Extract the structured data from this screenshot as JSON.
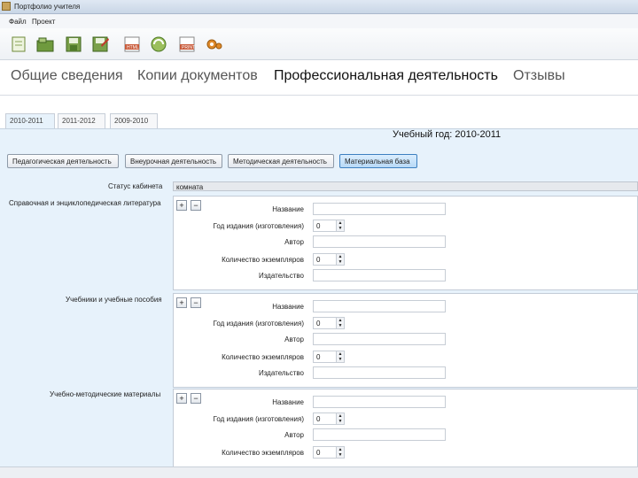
{
  "window": {
    "title": "Портфолио учителя"
  },
  "menu": {
    "items": [
      "Файл",
      "Проект"
    ]
  },
  "toolbar": {
    "icons": [
      "new-document-icon",
      "open-folder-icon",
      "save-icon",
      "save-as-icon",
      "export-html-icon",
      "refresh-icon",
      "print-icon",
      "settings-gear-icon"
    ]
  },
  "nav": {
    "tabs": [
      {
        "label": "Общие сведения",
        "active": false
      },
      {
        "label": "Копии документов",
        "active": false
      },
      {
        "label": "Профессиональная деятельность",
        "active": true
      },
      {
        "label": "Отзывы",
        "active": false
      }
    ]
  },
  "year_tabs": [
    {
      "label": "2010-2011",
      "active": true
    },
    {
      "label": "2011-2012",
      "active": false
    },
    {
      "label": "2009-2010",
      "active": false
    }
  ],
  "content": {
    "study_year": "Учебный год: 2010-2011",
    "sub_buttons": [
      {
        "label": "Педагогическая деятельность",
        "active": false
      },
      {
        "label": "Внеурочная деятельность",
        "active": false
      },
      {
        "label": "Методическая деятельность",
        "active": false
      },
      {
        "label": "Материальная база",
        "active": true
      }
    ],
    "status": {
      "label": "Статус кабинета",
      "value": "комната"
    },
    "plus_label": "+",
    "minus_label": "−",
    "sections": [
      {
        "label": "Справочная и энциклопедическая литература",
        "fields": {
          "title": "Название",
          "year": "Год издания (изготовления)",
          "year_value": "0",
          "author": "Автор",
          "count": "Количество экземпляров",
          "count_value": "0",
          "publisher": "Издательство"
        }
      },
      {
        "label": "Учебники и учебные пособия",
        "fields": {
          "title": "Название",
          "year": "Год издания (изготовления)",
          "year_value": "0",
          "author": "Автор",
          "count": "Количество экземпляров",
          "count_value": "0",
          "publisher": "Издательство"
        }
      },
      {
        "label": "Учебно-методические материалы",
        "fields": {
          "title": "Название",
          "year": "Год издания (изготовления)",
          "year_value": "0",
          "author": "Автор",
          "count": "Количество экземпляров",
          "count_value": "0"
        }
      }
    ]
  }
}
